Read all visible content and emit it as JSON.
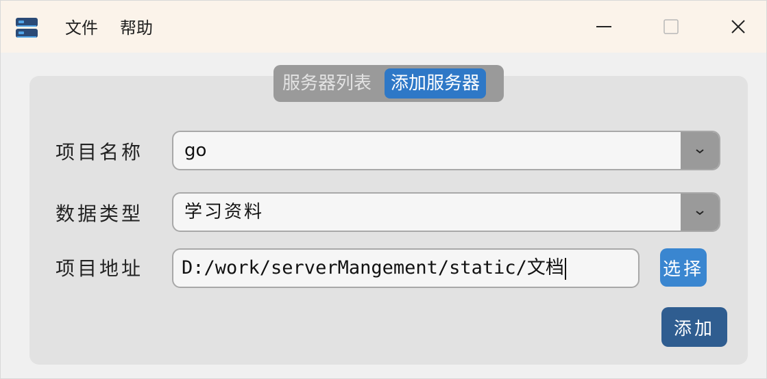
{
  "menu": {
    "file": "文件",
    "help": "帮助"
  },
  "tabs": [
    {
      "label": "服务器列表",
      "active": false
    },
    {
      "label": "添加服务器",
      "active": true
    }
  ],
  "form": {
    "project_name_label": "项目名称",
    "project_name_value": "go",
    "data_type_label": "数据类型",
    "data_type_value": "学习资料",
    "project_path_label": "项目地址",
    "project_path_value": "D:/work/serverMangement/static/文档"
  },
  "buttons": {
    "select": "选择",
    "add": "添加"
  },
  "icons": {
    "app": "server-icon",
    "minimize": "minimize-icon",
    "maximize": "maximize-icon",
    "close": "close-icon",
    "dropdown": "chevron-down-icon"
  },
  "colors": {
    "active_tab": "#2e78c7",
    "select_button": "#3a86d0",
    "add_button": "#2f5d90",
    "titlebar": "#fbf3ea"
  }
}
